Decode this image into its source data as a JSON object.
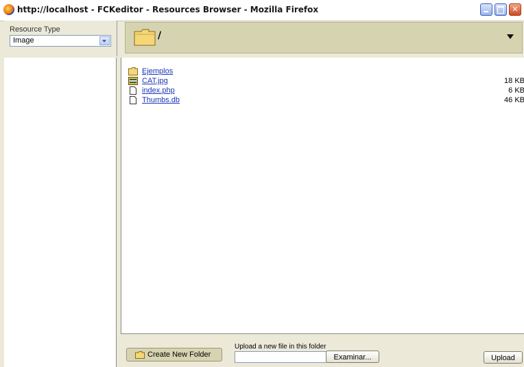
{
  "window": {
    "title": "http://localhost - FCKeditor - Resources Browser - Mozilla Firefox"
  },
  "resource_type": {
    "label": "Resource Type",
    "selected": "Image"
  },
  "path": {
    "current": "/"
  },
  "files": [
    {
      "name": "Ejemplos",
      "type": "folder",
      "size": ""
    },
    {
      "name": "CAT.jpg",
      "type": "image",
      "size": "18 KB"
    },
    {
      "name": "index.php",
      "type": "file",
      "size": "6 KB"
    },
    {
      "name": "Thumbs.db",
      "type": "file",
      "size": "46 KB"
    }
  ],
  "toolbar": {
    "create_folder_label": "Create New Folder",
    "upload_label": "Upload a new file in this folder",
    "browse_label": "Examinar...",
    "upload_button": "Upload"
  }
}
